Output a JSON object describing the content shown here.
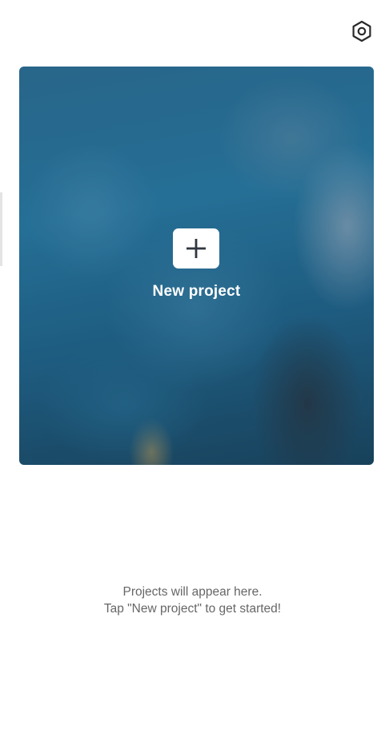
{
  "header": {
    "settings_icon": "settings-hexagon-icon"
  },
  "hero": {
    "plus_icon": "plus-icon",
    "label": "New project"
  },
  "empty_state": {
    "line1": "Projects will appear here.",
    "line2": "Tap \"New project\" to get started!"
  },
  "colors": {
    "background": "#ffffff",
    "hero_label": "#ffffff",
    "empty_text": "#666666"
  }
}
